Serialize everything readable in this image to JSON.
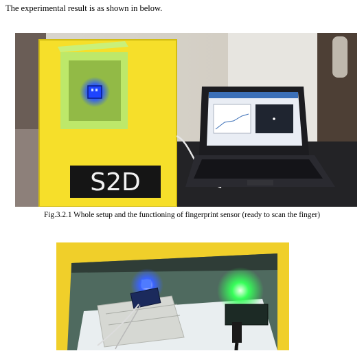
{
  "document": {
    "intro_text": "The experimental result is as shown in below.",
    "figure_1": {
      "caption": "Fig.3.2.1  Whole setup and the functioning of fingerprint sensor (ready to scan the finger)",
      "box_label": "S2D"
    },
    "figure_2": {
      "caption": ""
    }
  },
  "colors": {
    "box_yellow": "#f6df2a",
    "sensor_blue": "#2a57ff",
    "led_green": "#37ff5a",
    "laptop_black": "#1c1c20"
  }
}
